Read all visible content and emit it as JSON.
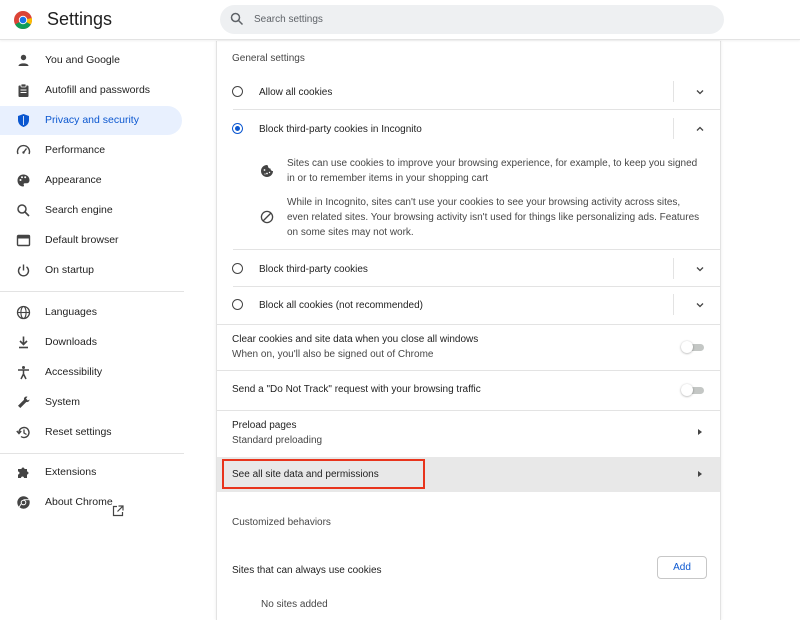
{
  "header": {
    "title": "Settings",
    "search_placeholder": "Search settings"
  },
  "sidebar": {
    "items": [
      {
        "label": "You and Google",
        "icon": "person-icon"
      },
      {
        "label": "Autofill and passwords",
        "icon": "clipboard-icon"
      },
      {
        "label": "Privacy and security",
        "icon": "shield-icon",
        "active": true
      },
      {
        "label": "Performance",
        "icon": "speedometer-icon"
      },
      {
        "label": "Appearance",
        "icon": "palette-icon"
      },
      {
        "label": "Search engine",
        "icon": "search-icon"
      },
      {
        "label": "Default browser",
        "icon": "browser-icon"
      },
      {
        "label": "On startup",
        "icon": "power-icon"
      },
      {
        "label": "Languages",
        "icon": "globe-icon"
      },
      {
        "label": "Downloads",
        "icon": "download-icon"
      },
      {
        "label": "Accessibility",
        "icon": "accessibility-icon"
      },
      {
        "label": "System",
        "icon": "wrench-icon"
      },
      {
        "label": "Reset settings",
        "icon": "restore-icon"
      },
      {
        "label": "Extensions",
        "icon": "puzzle-icon"
      },
      {
        "label": "About Chrome",
        "icon": "chrome-icon"
      }
    ]
  },
  "main": {
    "general_heading": "General settings",
    "options": [
      {
        "label": "Allow all cookies",
        "selected": false,
        "expanded": false
      },
      {
        "label": "Block third-party cookies in Incognito",
        "selected": true,
        "expanded": true
      },
      {
        "label": "Block third-party cookies",
        "selected": false,
        "expanded": false
      },
      {
        "label": "Block all cookies (not recommended)",
        "selected": false,
        "expanded": false
      }
    ],
    "info": {
      "cookie_line1": "Sites can use cookies to improve your browsing experience, for example, to keep you signed",
      "cookie_line2": "in or to remember items in your shopping cart",
      "blocked_line1": "While in Incognito, sites can't use your cookies to see your browsing activity across sites,",
      "blocked_line2": "even related sites. Your browsing activity isn't used for things like personalizing ads. Features",
      "blocked_line3": "on some sites may not work."
    },
    "clear_on_close": {
      "title": "Clear cookies and site data when you close all windows",
      "subtitle": "When on, you'll also be signed out of Chrome",
      "enabled": false
    },
    "do_not_track": {
      "title": "Send a \"Do Not Track\" request with your browsing traffic",
      "enabled": false
    },
    "preload": {
      "title": "Preload pages",
      "subtitle": "Standard preloading"
    },
    "site_data_link": "See all site data and permissions",
    "customized_heading": "Customized behaviors",
    "always_allow": {
      "label": "Sites that can always use cookies",
      "add_label": "Add",
      "empty": "No sites added"
    }
  },
  "colors": {
    "accent": "#0b57d0",
    "active_nav_bg": "#e8f0fe",
    "highlight_border": "#e8341c"
  }
}
